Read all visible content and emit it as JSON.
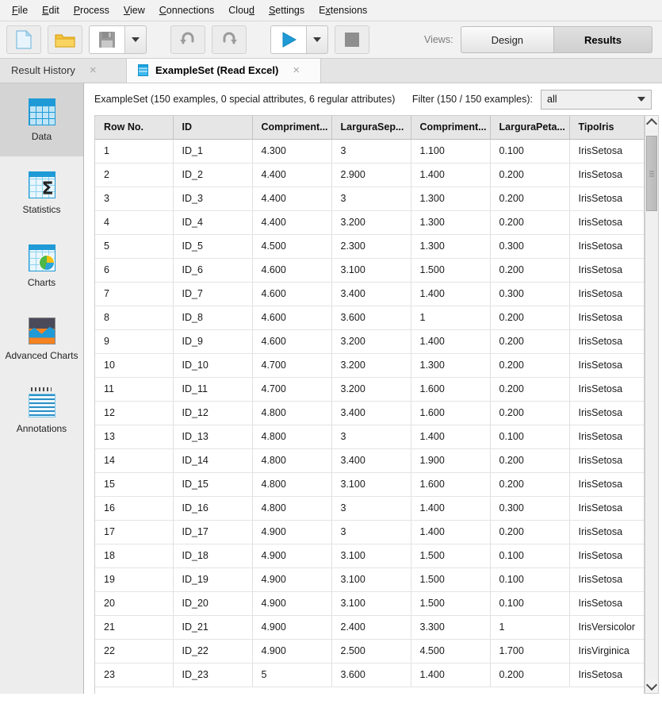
{
  "menubar": {
    "items": [
      {
        "label": "File",
        "mnemonic": "F"
      },
      {
        "label": "Edit",
        "mnemonic": "E"
      },
      {
        "label": "Process",
        "mnemonic": "P"
      },
      {
        "label": "View",
        "mnemonic": "V"
      },
      {
        "label": "Connections",
        "mnemonic": "C"
      },
      {
        "label": "Cloud",
        "mnemonic": "d"
      },
      {
        "label": "Settings",
        "mnemonic": "S"
      },
      {
        "label": "Extensions",
        "mnemonic": "x"
      }
    ]
  },
  "toolbar": {
    "new_process_icon": "new-document-icon",
    "open_process_icon": "open-folder-icon",
    "save_icon": "save-floppy-icon",
    "save_dropdown_icon": "chevron-down-icon",
    "undo_icon": "undo-arrow-icon",
    "redo_icon": "redo-arrow-icon",
    "run_icon": "run-play-icon",
    "run_dropdown_icon": "chevron-down-icon",
    "stop_icon": "stop-square-icon",
    "views_label": "Views:",
    "views": [
      {
        "label": "Design",
        "active": false
      },
      {
        "label": "Results",
        "active": true
      }
    ]
  },
  "tabs": [
    {
      "label": "Result History",
      "active": false,
      "close": "×",
      "icon": null
    },
    {
      "label": "ExampleSet (Read Excel)",
      "active": true,
      "close": "×",
      "icon": "exampleset-table-icon"
    }
  ],
  "sidebar": {
    "items": [
      {
        "label": "Data",
        "icon": "data-grid-icon",
        "active": true
      },
      {
        "label": "Statistics",
        "icon": "statistics-sigma-icon",
        "active": false
      },
      {
        "label": "Charts",
        "icon": "charts-pie-icon",
        "active": false
      },
      {
        "label": "Advanced Charts",
        "icon": "advanced-charts-icon",
        "active": false
      },
      {
        "label": "Annotations",
        "icon": "annotations-notepad-icon",
        "active": false
      }
    ]
  },
  "main": {
    "summary": "ExampleSet (150 examples, 0 special attributes, 6 regular attributes)",
    "filter_label": "Filter (150 / 150 examples):",
    "filter_value": "all",
    "filter_caret_icon": "chevron-down-icon"
  },
  "table": {
    "columns": [
      "Row No.",
      "ID",
      "Compriment...",
      "LarguraSep...",
      "Compriment...",
      "LarguraPeta...",
      "TipoIris"
    ],
    "rows": [
      [
        "1",
        "ID_1",
        "4.300",
        "3",
        "1.100",
        "0.100",
        "IrisSetosa"
      ],
      [
        "2",
        "ID_2",
        "4.400",
        "2.900",
        "1.400",
        "0.200",
        "IrisSetosa"
      ],
      [
        "3",
        "ID_3",
        "4.400",
        "3",
        "1.300",
        "0.200",
        "IrisSetosa"
      ],
      [
        "4",
        "ID_4",
        "4.400",
        "3.200",
        "1.300",
        "0.200",
        "IrisSetosa"
      ],
      [
        "5",
        "ID_5",
        "4.500",
        "2.300",
        "1.300",
        "0.300",
        "IrisSetosa"
      ],
      [
        "6",
        "ID_6",
        "4.600",
        "3.100",
        "1.500",
        "0.200",
        "IrisSetosa"
      ],
      [
        "7",
        "ID_7",
        "4.600",
        "3.400",
        "1.400",
        "0.300",
        "IrisSetosa"
      ],
      [
        "8",
        "ID_8",
        "4.600",
        "3.600",
        "1",
        "0.200",
        "IrisSetosa"
      ],
      [
        "9",
        "ID_9",
        "4.600",
        "3.200",
        "1.400",
        "0.200",
        "IrisSetosa"
      ],
      [
        "10",
        "ID_10",
        "4.700",
        "3.200",
        "1.300",
        "0.200",
        "IrisSetosa"
      ],
      [
        "11",
        "ID_11",
        "4.700",
        "3.200",
        "1.600",
        "0.200",
        "IrisSetosa"
      ],
      [
        "12",
        "ID_12",
        "4.800",
        "3.400",
        "1.600",
        "0.200",
        "IrisSetosa"
      ],
      [
        "13",
        "ID_13",
        "4.800",
        "3",
        "1.400",
        "0.100",
        "IrisSetosa"
      ],
      [
        "14",
        "ID_14",
        "4.800",
        "3.400",
        "1.900",
        "0.200",
        "IrisSetosa"
      ],
      [
        "15",
        "ID_15",
        "4.800",
        "3.100",
        "1.600",
        "0.200",
        "IrisSetosa"
      ],
      [
        "16",
        "ID_16",
        "4.800",
        "3",
        "1.400",
        "0.300",
        "IrisSetosa"
      ],
      [
        "17",
        "ID_17",
        "4.900",
        "3",
        "1.400",
        "0.200",
        "IrisSetosa"
      ],
      [
        "18",
        "ID_18",
        "4.900",
        "3.100",
        "1.500",
        "0.100",
        "IrisSetosa"
      ],
      [
        "19",
        "ID_19",
        "4.900",
        "3.100",
        "1.500",
        "0.100",
        "IrisSetosa"
      ],
      [
        "20",
        "ID_20",
        "4.900",
        "3.100",
        "1.500",
        "0.100",
        "IrisSetosa"
      ],
      [
        "21",
        "ID_21",
        "4.900",
        "2.400",
        "3.300",
        "1",
        "IrisVersicolor"
      ],
      [
        "22",
        "ID_22",
        "4.900",
        "2.500",
        "4.500",
        "1.700",
        "IrisVirginica"
      ],
      [
        "23",
        "ID_23",
        "5",
        "3.600",
        "1.400",
        "0.200",
        "IrisSetosa"
      ]
    ]
  },
  "scrollbar": {
    "up_icon": "chevron-up-icon",
    "down_icon": "chevron-down-icon",
    "thumb": "scroll-thumb"
  },
  "colors": {
    "accent_blue": "#1f9ad6",
    "run_green": "#2aa3db",
    "chrome_bg": "#f2f2f2",
    "sidebar_bg": "#ededed",
    "header_bg": "#e6e6e6"
  }
}
